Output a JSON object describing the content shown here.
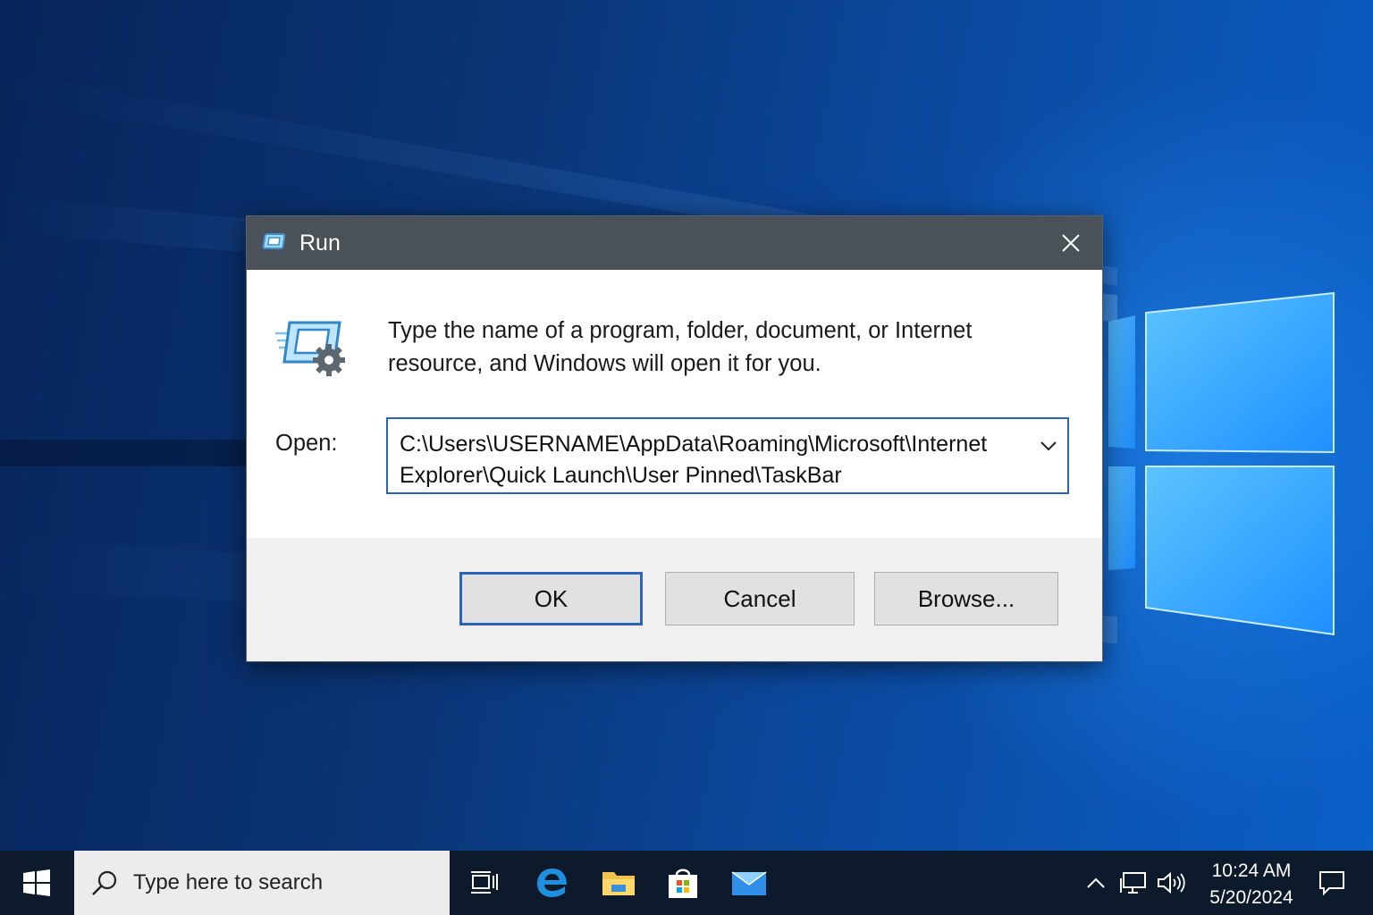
{
  "dialog": {
    "title": "Run",
    "description": "Type the name of a program, folder, document, or Internet resource, and Windows will open it for you.",
    "open_label": "Open:",
    "open_value": "C:\\Users\\USERNAME\\AppData\\Roaming\\Microsoft\\Internet Explorer\\Quick Launch\\User Pinned\\TaskBar",
    "buttons": {
      "ok": "OK",
      "cancel": "Cancel",
      "browse": "Browse..."
    },
    "icons": {
      "title": "run-icon",
      "close": "close-icon",
      "dropdown": "chevron-down-icon",
      "main": "run-program-icon"
    }
  },
  "taskbar": {
    "search_placeholder": "Type here to search",
    "pinned_apps": [
      "task-view",
      "edge",
      "file-explorer",
      "store",
      "mail"
    ],
    "tray_icons": [
      "chevron-up-icon",
      "network-icon",
      "volume-icon"
    ],
    "clock": {
      "time": "10:24 AM",
      "date": "5/20/2024"
    }
  },
  "colors": {
    "accent": "#2a63b8",
    "titlebar": "#4b5159",
    "taskbar": "#0d1a2c"
  }
}
